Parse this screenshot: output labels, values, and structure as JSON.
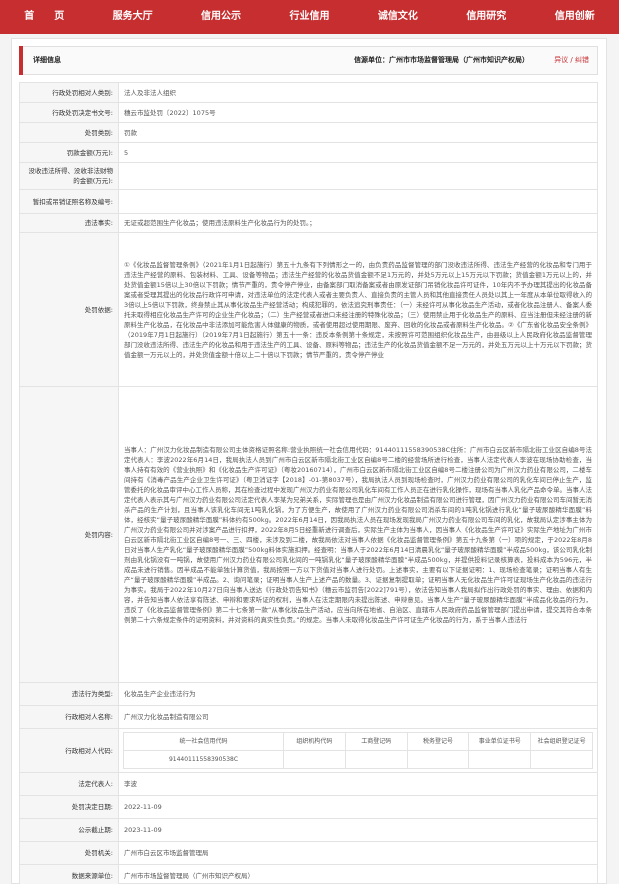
{
  "nav": [
    {
      "label": "首　　页"
    },
    {
      "label": "服务大厅"
    },
    {
      "label": "信用公示"
    },
    {
      "label": "行业信用"
    },
    {
      "label": "诚信文化"
    },
    {
      "label": "信用研究"
    },
    {
      "label": "信用创新"
    }
  ],
  "header": {
    "title": "详细信息",
    "source": "信源单位：广州市市场监督管理局（广州市知识产权局）",
    "report": "异议 / 纠错"
  },
  "rows": [
    {
      "label": "行政处罚相对人类别:",
      "value": "法人及非法人组织"
    },
    {
      "label": "行政处罚决定书文号:",
      "value": "穗云市监处罚〔2022〕1075号"
    },
    {
      "label": "处罚类别:",
      "value": "罚款"
    },
    {
      "label": "罚款金额(万元):",
      "value": "5"
    },
    {
      "label": "没收违法所得、没收非法财物的金额(万元):",
      "value": ""
    },
    {
      "label": "暂扣或吊销证照名称及编号:",
      "value": ""
    },
    {
      "label": "违法事实:",
      "value": "无证或超范围生产化妆品；使用违法原料生产化妆品行为的处罚。；"
    },
    {
      "label": "处罚依据:",
      "value": "①《化妆品监督管理条例》（2021年1月1日起施行）第五十九条有下列情形之一的，由负责药品监督管理的部门没收违法所得、违法生产经营的化妆品和专门用于违法生产经营的原料、包装材料、工具、设备等物品；违法生产经营的化妆品货值金额不足1万元的，并处5万元以上15万元以下罚款；货值金额1万元以上的，并处货值金额15倍以上30倍以下罚款；情节严重的，责令停产停业，由备案部门取消备案或者由原发证部门吊销化妆品许可证件，10年内不予办理其提出的化妆品备案或者受理其提出的化妆品行政许可申请，对违法单位的法定代表人或者主要负责人、直接负责的主管人员和其他直接责任人员处以其上一年度从本单位取得收入的3倍以上5倍以下罚款，终身禁止其从事化妆品生产经营活动；构成犯罪的，依法追究刑事责任：（一）未经许可从事化妆品生产活动，或者化妆品注册人、备案人委托未取得相应化妆品生产许可的企业生产化妆品；（二）生产经营或者进口未经注册的特殊化妆品；（三）使用禁止用于化妆品生产的原料、应当注册但未经注册的新原料生产化妆品，在化妆品中非法添加可能危害人体健康的物质，或者使用超过使用期限、废弃、回收的化妆品或者原料生产化妆品。②《广东省化妆品安全条例》（2019年7月1日起施行）（2019年7月1日起施行）第五十一条：违反本条例第十条规定，未按照许可范围组织化妆品生产，由县级以上人民政府化妆品监督管理部门没收违法所得、违法生产的化妆品和用于违法生产的工具、设备、原料等物品；违法生产的化妆品货值金额不足一万元的，并处五万元以上十万元以下罚款；货值金额一万元以上的，并处货值金额十倍以上二十倍以下罚款；情节严重的，责令停产停业"
    },
    {
      "label": "处罚内容:",
      "value": "当事人：广州汉力化妆品制造有限公司主体资格证照名称:营业执照统一社会信用代码：91440111558390538C住所：广州市白云区新市隔北街工业区自编8号法定代表人：李波2022年6月14日，我局执法人员到广州市白云区新市隔北街工业区自编8号二楼的经营场所进行检查，当事人法定代表人李波在现场协助检查，当事人持有有效的《营业执照》和《化妆品生产许可证》（粤妆20160714），广州市白云区新市隔北街工业区自编8号二楼注册公司为广州汉力药业有限公司，二楼车间持有《消毒产品生产企业卫生许可证》（粤卫消证字【2018】-01-第8037号），我局执法人员到现场检查时，广州汉力药业有限公司的乳化车间已停止生产，监管委托的化妆品审评中心工作人员称，其在检查过程中发现广州汉力药业有限公司乳化车间有工作人员正在进行乳化操作，现场有当事人乳化产品命令单。当事人法定代表人表示其与广州汉力药业有限公司法定代表人李某为兄弟关系，实际管理也是由广州汉力化妆品制造有限公司进行管理，因广州汉力药业有限公司车间暂无消杀产品的生产计划，且当事人该乳化车间无1吨乳化锅，为了方便生产，故使用了广州汉力药业有限公司消杀车间的1吨乳化锅进行乳化“量子玻尿酸精华面膜”料体，经核实“量子玻尿酸精华面膜”料体约有500kg。2022年6月14日，因我局执法人员在现场发现我局广州汉力药业有限公司车间的乳化，故我局认定涉事主体为广州汉力药业有限公司并对涉案产品进行扣押，2022年8月5日经重新进行调查后，实际生产主体为当事人，因当事人《化妆品生产许可证》实际生产地址为广州市白云区新市隔北街工业区自编8号一、三、四楼，未涉及到二楼，故我局依法对当事人依据《化妆品监督管理条例》第五十九条第（一）项的规定，于2022年8月8日对当事人生产乳化“量子玻尿酸精华面膜”500kg料体实施扣押。经查明：当事人于2022年6月14日清晨乳化“量子玻尿酸精华面膜”半成品500kg，该公司乳化制剂由乳化锅没有一吨锅，故使用广州汉力药业有限公司乳化间的一吨锅乳化“量子玻尿酸精华面膜”半成品500kg，并提供投料记录核算表，投料成本为596元，半成品未进行销售。因半成品不能单独计算货值，我局按照一方以下货值对当事人进行处罚。上述事实，主要有以下证据证明：1、现场检查笔录；证明当事人有生产“量子玻尿酸精华面膜”半成品。2、询问笔录；证明当事人生产上述产品的数量。3、证据复制提取单；证明当事人无化妆品生产许可证现场生产化妆品的违法行为事实。我局于2022年10月27日向当事人送达《行政处罚告知书》（穗云市监罚告[2022]791号），依法告知当事人我局拟作出行政处罚的事实、理由、依据和内容，并告知当事人依法享有陈述、申辩和要求听证的权利，当事人在法定期限内未提出陈述、申辩意见。当事人生产“量子玻尿酸精华面膜”半成品化妆品的行为，违反了《化妆品监督管理条例》第二十七条第一款“从事化妆品生产活动，应当向所在地省、自治区、直辖市人民政府药品监督管理部门提出申请，提交其符合本条例第二十六条规定条件的证明资料，并对资料的真实性负责。”的规定。当事人未取得化妆品生产许可证生产化妆品的行为，系于当事人违法行"
    },
    {
      "label": "违法行为类型:",
      "value": "化妆品生产企业违法行为"
    },
    {
      "label": "行政相对人名称:",
      "value": "广州汉力化妆品制造有限公司"
    }
  ],
  "code_block": {
    "label": "行政相对人代码:",
    "headers": [
      "统一社会信用代码",
      "组织机构代码",
      "工商登记码",
      "税务登记号",
      "事业单位证书号",
      "社会组织登记证号"
    ],
    "values": [
      "91440111558390538C",
      "",
      "",
      "",
      "",
      ""
    ]
  },
  "rows_after": [
    {
      "label": "法定代表人:",
      "value": "李波"
    },
    {
      "label": "处罚决定日期:",
      "value": "2022-11-09"
    },
    {
      "label": "公示截止期:",
      "value": "2023-11-09"
    },
    {
      "label": "处罚机关:",
      "value": "广州市白云区市场监督管理局"
    },
    {
      "label": "数据来源单位:",
      "value": "广州市市场监督管理局（广州市知识产权局）"
    }
  ]
}
